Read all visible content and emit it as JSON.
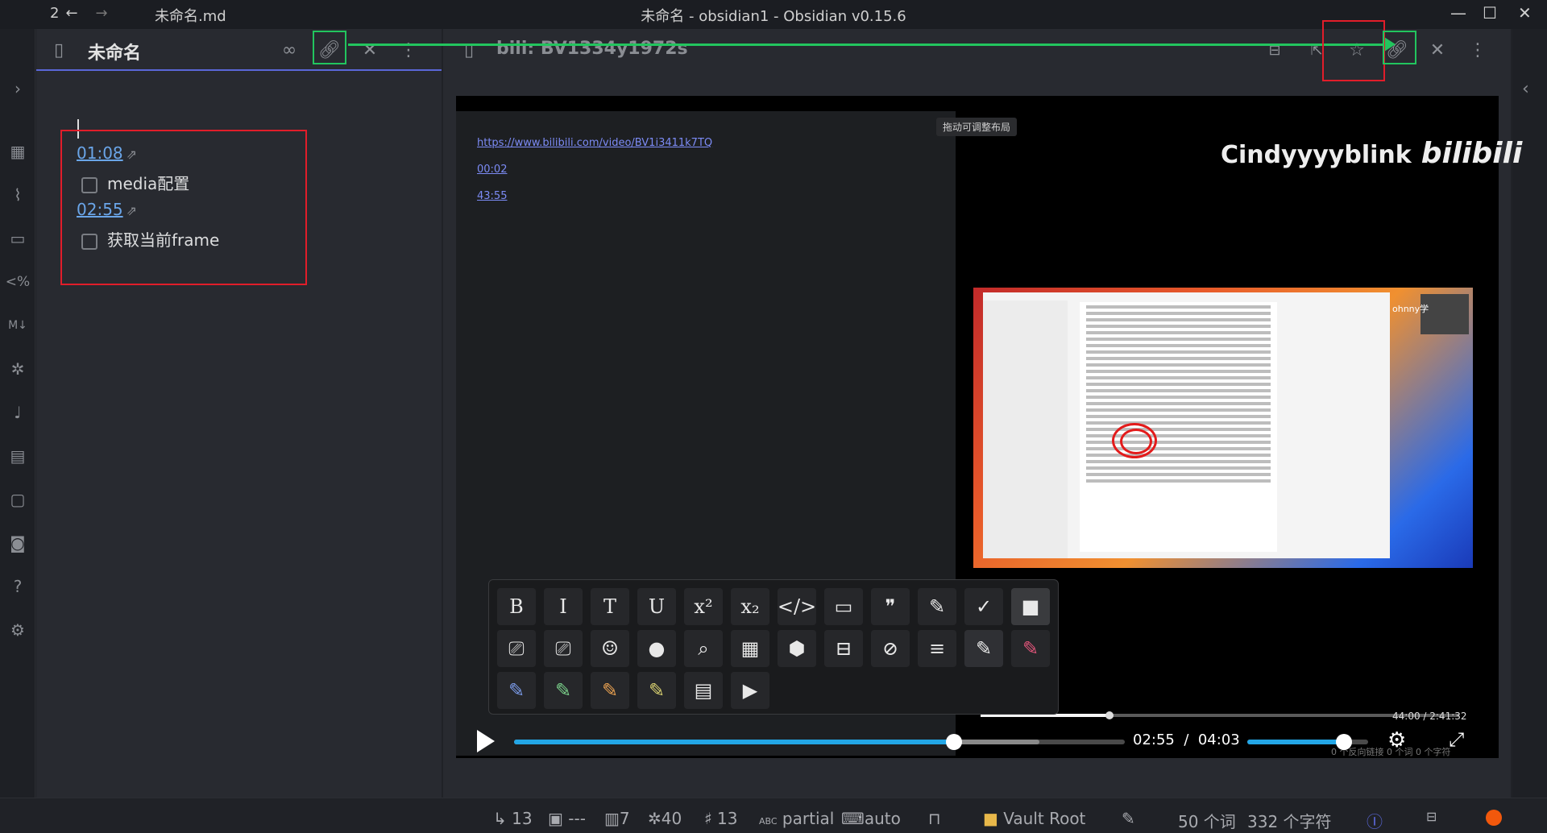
{
  "titlebar": {
    "nav_count": "2",
    "back_glyph": "←",
    "forward_glyph": "→",
    "filename": "未命名.md",
    "window_title": "未命名 - obsidian1 - Obsidian v0.15.6",
    "minimize": "—",
    "maximize": "☐",
    "close": "✕"
  },
  "left_pane": {
    "tab_title": "未命名",
    "icons": [
      "file-icon",
      "glasses-icon",
      "link-icon",
      "close-icon",
      "more-icon"
    ],
    "doc": {
      "items": [
        {
          "timestamp": "01:08",
          "task": "media配置"
        },
        {
          "timestamp": "02:55",
          "task": "获取当前frame"
        }
      ]
    }
  },
  "right_pane": {
    "tab_title": "bili: BV1334y1972s",
    "notes_links": [
      "https://www.bilibili.com/video/BV1i3411k7TQ",
      "00:02",
      "43:55"
    ],
    "tooltip": "拖动可调整布局",
    "brand_name": "Cindyyyyblink",
    "brand_logo": "bilibili",
    "inner_webcam_label": "ohnny学",
    "inner_time": "44:00 / 2:41:32",
    "inner_progress": 0.27,
    "player": {
      "current": "02:55",
      "separator": "/",
      "total": "04:03",
      "progress": 0.72,
      "buffered": 0.86,
      "volume": 0.8
    },
    "watermark": "0 个反向链接   0 个词   0 个字符"
  },
  "toolbar_rows": [
    [
      "B",
      "I",
      "T",
      "U",
      "x²",
      "x₂",
      "</>",
      "▭",
      "❞",
      "✎",
      "✓",
      "■"
    ],
    [
      "⎚",
      "⎚",
      "☺",
      "●",
      "⌕",
      "▦",
      "⬢",
      "⊟",
      "⊘",
      "≡",
      "✎",
      "✎"
    ],
    [
      "✎",
      "✎",
      "✎",
      "✎",
      "▤",
      "▶"
    ]
  ],
  "statusbar": {
    "backlinks": "13",
    "outline": "---",
    "stats": "7",
    "graph": "40",
    "tags": "13",
    "spellcheck": "partial",
    "keyboard": "auto",
    "vault": "Vault Root",
    "words": "50 个词",
    "chars": "332 个字符"
  },
  "colors": {
    "accent": "#5a67d8",
    "green_annotation": "#22c55e",
    "red_annotation": "#e11d2a",
    "progress": "#23a6e6"
  }
}
